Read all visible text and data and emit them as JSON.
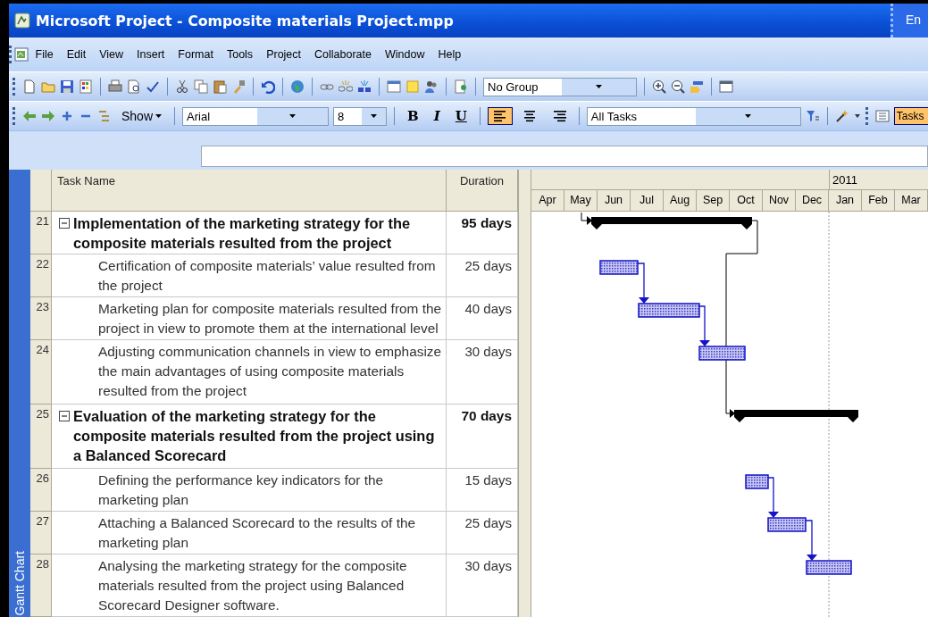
{
  "window": {
    "title": "Microsoft Project - Composite materials Project.mpp",
    "language_button": "En"
  },
  "menu_bar": {
    "items": [
      "File",
      "Edit",
      "View",
      "Insert",
      "Format",
      "Tools",
      "Project",
      "Collaborate",
      "Window",
      "Help"
    ]
  },
  "standard_toolbar": {
    "group_dropdown": {
      "value": "No Group"
    }
  },
  "formatting_toolbar": {
    "show_button": "Show",
    "font": {
      "value": "Arial"
    },
    "size": {
      "value": "8"
    },
    "bold_button": "B",
    "italic_button": "I",
    "underline_button": "U",
    "align_buttons": [
      {
        "kind": "left",
        "selected": true
      },
      {
        "kind": "center",
        "selected": false
      },
      {
        "kind": "right",
        "selected": false
      }
    ],
    "filter_dropdown": {
      "value": "All Tasks"
    },
    "tasks_button": "Tasks"
  },
  "view_bar": {
    "label": "Gantt Chart"
  },
  "table": {
    "columns": [
      "Task Name",
      "Duration"
    ],
    "tasks": [
      {
        "id": "21",
        "name": "Implementation of the marketing strategy for the composite materials resulted from the project",
        "duration": "95 days",
        "expanded": true,
        "children": [
          {
            "id": "22",
            "name": "Certification of composite materials’ value resulted from the project",
            "duration": "25 days"
          },
          {
            "id": "23",
            "name": "Marketing plan for composite materials resulted from the project in view to promote them at the international level",
            "duration": "40 days"
          },
          {
            "id": "24",
            "name": "Adjusting communication channels in view to emphasize the main advantages of using composite materials resulted from the project",
            "duration": "30 days"
          }
        ]
      },
      {
        "id": "25",
        "name": "Evaluation of the marketing strategy for the composite materials resulted from the project using a Balanced Scorecard",
        "duration": "70 days",
        "expanded": true,
        "children": [
          {
            "id": "26",
            "name": "Defining the performance key indicators for the marketing plan",
            "duration": "15 days"
          },
          {
            "id": "27",
            "name": "Attaching a Balanced Scorecard to the results of the marketing plan",
            "duration": "25 days"
          },
          {
            "id": "28",
            "name": "Analysing the marketing strategy for the composite materials resulted from the project using Balanced Scorecard Designer software.",
            "duration": "30 days"
          }
        ]
      }
    ]
  },
  "timescale": {
    "year": "2011",
    "months": [
      "Apr",
      "May",
      "Jun",
      "Jul",
      "Aug",
      "Sep",
      "Oct",
      "Nov",
      "Dec",
      "Jan",
      "Feb",
      "Mar"
    ]
  }
}
